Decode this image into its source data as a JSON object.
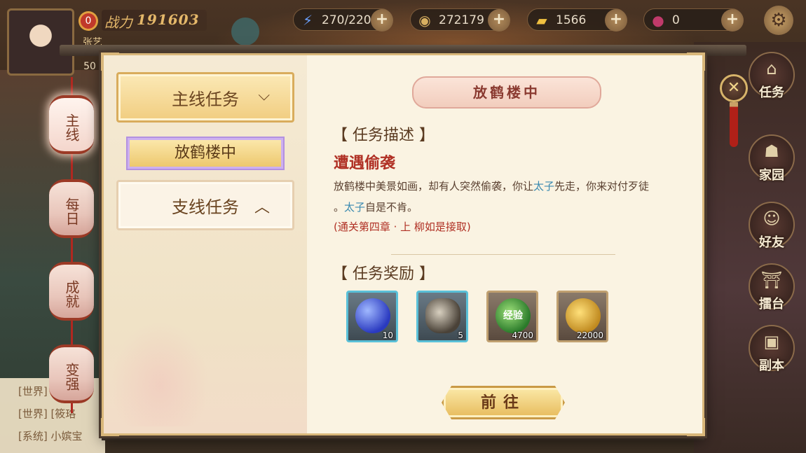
{
  "hud": {
    "vip": "0",
    "power_label": "战力",
    "power": "191603",
    "player_name": "张艺",
    "level": "50",
    "resources": [
      {
        "icon": "energy-icon",
        "value": "270/220"
      },
      {
        "icon": "coin-icon",
        "value": "272179"
      },
      {
        "icon": "ingot-icon",
        "value": "1566"
      },
      {
        "icon": "jade-icon",
        "value": "0"
      }
    ],
    "plus": "+"
  },
  "left_tabs": [
    "主线",
    "每日",
    "成就",
    "变强"
  ],
  "right_buttons": [
    "任务",
    "家园",
    "好友",
    "擂台",
    "副本"
  ],
  "dialog": {
    "categories": {
      "main": "主线任务",
      "sub_item": "放鹤楼中",
      "side": "支线任务"
    },
    "quest_title": "放鹤楼中",
    "desc_head": "【 任务描述 】",
    "quest_name": "遭遇偷袭",
    "desc_1": "放鹤楼中美景如画，却有人突然偷袭，你让",
    "desc_name_1": "太子",
    "desc_2": "先走，你来对付歹徒",
    "desc_3": "。",
    "desc_name_2": "太子",
    "desc_4": "自是不肯。",
    "condition": "(通关第四章 · 上 柳如是接取)",
    "reward_head": "【 任务奖励 】",
    "rewards": [
      {
        "name": "blue-orb-icon",
        "qty": "10"
      },
      {
        "name": "stone-icon",
        "qty": "5"
      },
      {
        "name": "exp-icon",
        "qty": "4700",
        "label": "经验"
      },
      {
        "name": "coin-bag-icon",
        "qty": "22000"
      }
    ],
    "go_button": "前往"
  },
  "chat": [
    "[世界]",
    "[世界] [筱珞",
    "[系统] 小嫔宝"
  ],
  "colors": {
    "accent": "#d9ac5c",
    "highlight": "#3a8ab0",
    "alert": "#b03024"
  }
}
